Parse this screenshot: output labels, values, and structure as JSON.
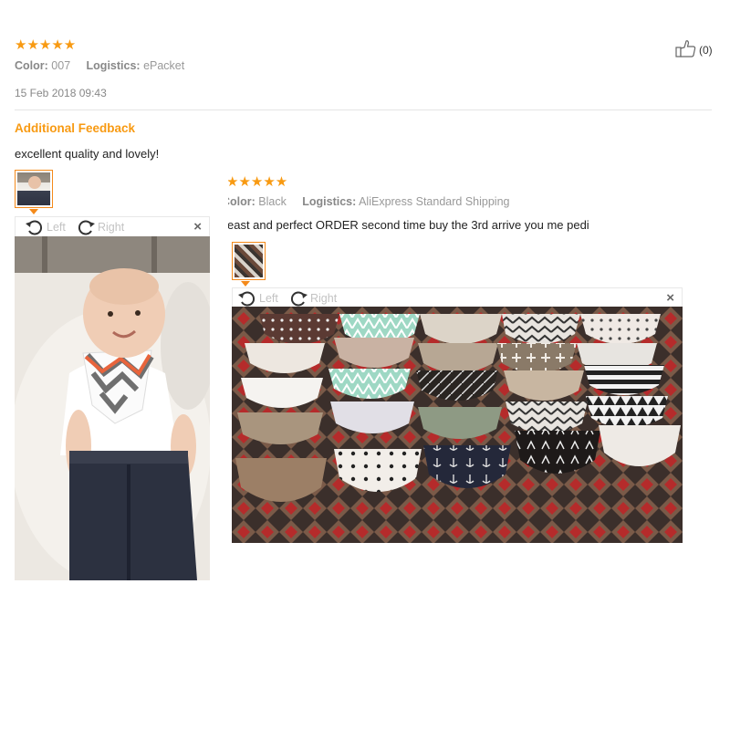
{
  "review1": {
    "stars": "★★★★★",
    "color_label": "Color:",
    "color_value": "007",
    "logistics_label": "Logistics:",
    "logistics_value": "ePacket",
    "date": "15 Feb 2018 09:43",
    "helpful_count": "(0)",
    "additional_feedback_title": "Additional Feedback",
    "feedback_text": "excellent quality and lovely!",
    "viewer": {
      "left_label": "Left",
      "right_label": "Right",
      "close_label": "×"
    }
  },
  "review2": {
    "stars": "★★★★★",
    "color_label": "Color:",
    "color_value": "Black",
    "logistics_label": "Logistics:",
    "logistics_value": "AliExpress Standard Shipping",
    "feedback_text": "east and perfect ORDER second time buy the 3rd arrive you me pedi",
    "viewer": {
      "left_label": "Left",
      "right_label": "Right",
      "close_label": "×"
    }
  },
  "colors": {
    "accent": "#f89a12",
    "thumb_border": "#f48a1a"
  },
  "icons": [
    "thumbs-up-icon",
    "rotate-left-icon",
    "rotate-right-icon",
    "close-icon"
  ]
}
